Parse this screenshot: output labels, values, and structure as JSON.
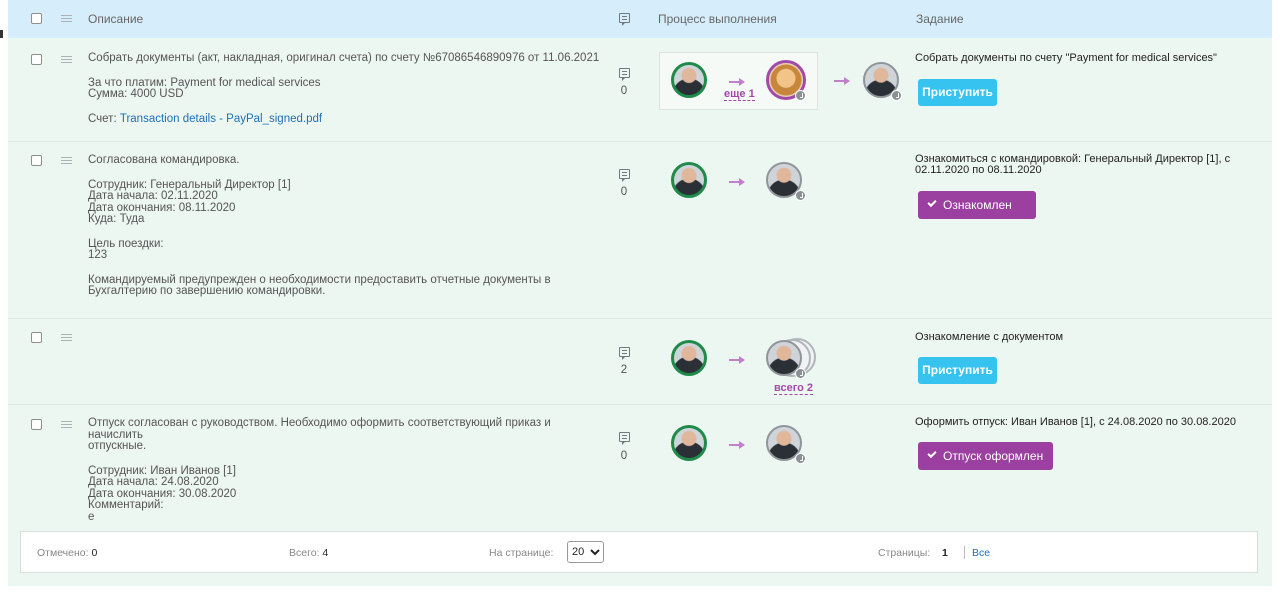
{
  "header": {
    "description_label": "Описание",
    "process_label": "Процесс выполнения",
    "task_label": "Задание"
  },
  "rows": [
    {
      "title": "Собрать документы (акт, накладная, оригинал счета) по счету №67086546890976 от 11.06.2021",
      "details": "За что платим: Payment for medical services\nСумма: 4000 USD",
      "invoice_label": "Счет:",
      "invoice_link": "Transaction details - PayPal_signed.pdf",
      "comments": "0",
      "more_label": "еще 1",
      "task": "Собрать документы по счету \"Payment for medical services\"",
      "button": "Приступить"
    },
    {
      "title": "Согласована командировка.",
      "details": "Сотрудник: Генеральный Директор [1]\nДата начала: 02.11.2020\nДата окончания: 08.11.2020\nКуда: Туда",
      "purpose": "Цель поездки:\n123",
      "note": "Командируемый предупрежден о необходимости предоставить отчетные документы в\nБухгалтерию по завершению командировки.",
      "comments": "0",
      "task": "Ознакомиться с командировкой: Генеральный Директор [1], с\n02.11.2020 по 08.11.2020",
      "button": "Ознакомлен"
    },
    {
      "comments": "2",
      "total_label": "всего 2",
      "task": "Ознакомление с документом",
      "button": "Приступить"
    },
    {
      "title": "Отпуск согласован с руководством. Необходимо оформить соответствующий приказ и начислить\nотпускные.",
      "details": "Сотрудник: Иван Иванов [1]\nДата начала: 24.08.2020\nДата окончания: 30.08.2020\nКомментарий:\nе",
      "comments": "0",
      "task": "Оформить отпуск: Иван Иванов [1], с 24.08.2020 по 30.08.2020",
      "button": "Отпуск оформлен"
    }
  ],
  "footer": {
    "checked_label": "Отмечено:",
    "checked_value": "0",
    "total_label": "Всего:",
    "total_value": "4",
    "per_page_label": "На странице:",
    "per_page_value": "20",
    "pages_label": "Страницы:",
    "current_page": "1",
    "all_label": "Все"
  },
  "colors": {
    "header_bg": "#d6eefb",
    "panel_bg": "#edf7f1",
    "blue_button": "#36c3f0",
    "purple_button": "#9b3fa0",
    "link": "#1f6fb5"
  }
}
